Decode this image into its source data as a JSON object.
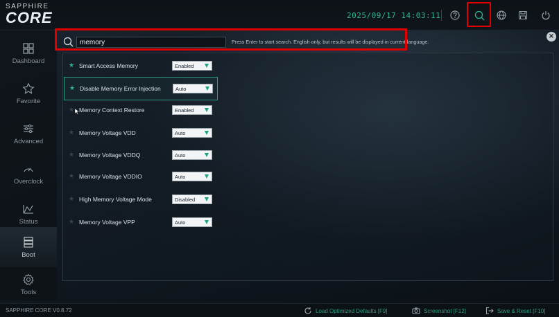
{
  "brand": {
    "top": "SAPPHIRE",
    "main": "CORE"
  },
  "datetime": "2025/09/17 14:03:11",
  "top_icons": [
    "help-icon",
    "search-icon",
    "globe-icon",
    "save-icon",
    "power-icon"
  ],
  "sidebar": {
    "items": [
      {
        "label": "Dashboard",
        "icon": "dashboard-icon"
      },
      {
        "label": "Favorite",
        "icon": "star-outline-icon"
      },
      {
        "label": "Advanced",
        "icon": "sliders-icon"
      },
      {
        "label": "Overclock",
        "icon": "gauge-icon"
      },
      {
        "label": "Status",
        "icon": "chart-icon"
      },
      {
        "label": "Boot",
        "icon": "boot-icon"
      },
      {
        "label": "Tools",
        "icon": "gear-icon"
      }
    ]
  },
  "search": {
    "value": "memory",
    "hint": "Press Enter to start search. English only, but results will be displayed in current language."
  },
  "results": [
    {
      "name": "Smart Access Memory",
      "value": "Enabled",
      "favorite": true
    },
    {
      "name": "Disable Memory Error Injection",
      "value": "Auto",
      "favorite": true
    },
    {
      "name": "Memory Context Restore",
      "value": "Enabled",
      "favorite": false
    },
    {
      "name": "Memory Voltage VDD",
      "value": "Auto",
      "favorite": false
    },
    {
      "name": "Memory Voltage VDDQ",
      "value": "Auto",
      "favorite": false
    },
    {
      "name": "Memory Voltage VDDIO",
      "value": "Auto",
      "favorite": false
    },
    {
      "name": "High Memory Voltage Mode",
      "value": "Disabled",
      "favorite": false
    },
    {
      "name": "Memory Voltage VPP",
      "value": "Auto",
      "favorite": false
    }
  ],
  "statusbar": {
    "version": "SAPPHIRE CORE V0.8.72",
    "load_defaults": "Load Optimized Defaults [F9]",
    "screenshot": "Screenshot [F12]",
    "save_reset": "Save & Reset [F10]"
  },
  "colors": {
    "accent": "#2fb78f",
    "highlight": "#e00000",
    "star_active": "#2fb78f",
    "star_inactive": "#3a4650"
  }
}
